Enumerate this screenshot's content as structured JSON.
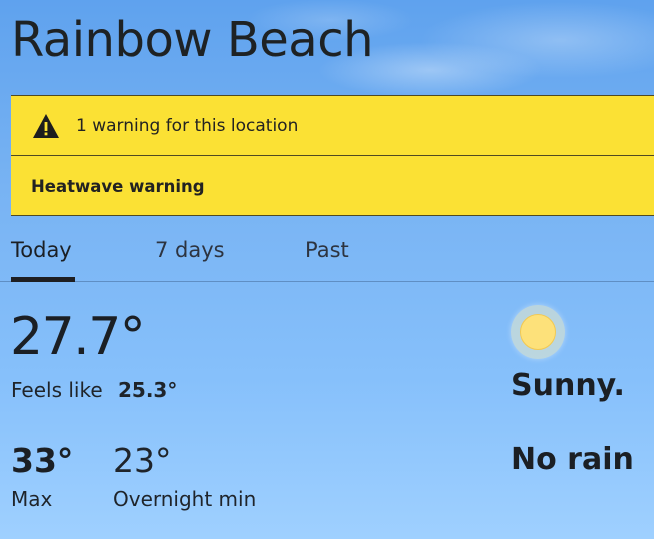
{
  "location": {
    "title": "Rainbow Beach"
  },
  "warnings": {
    "count_text": "1 warning for this location",
    "items": [
      {
        "label": "Heatwave warning"
      }
    ],
    "banner_color": "#fbe134"
  },
  "tabs": [
    {
      "label": "Today",
      "selected": true
    },
    {
      "label": "7 days",
      "selected": false
    },
    {
      "label": "Past",
      "selected": false
    }
  ],
  "current": {
    "temperature": "27.7°",
    "feels_like_label": "Feels like",
    "feels_like_value": "25.3°",
    "max_value": "33°",
    "max_label": "Max",
    "min_value": "23°",
    "min_label": "Overnight min",
    "condition_icon": "sun-icon",
    "condition": "Sunny.",
    "rain": "No rain"
  }
}
